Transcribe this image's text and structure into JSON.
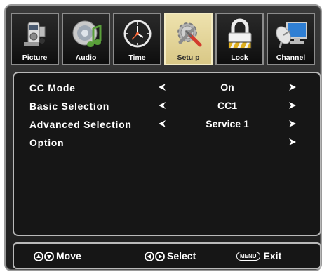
{
  "tabs": [
    {
      "label": "Picture",
      "icon": "camcorder-icon"
    },
    {
      "label": "Audio",
      "icon": "speaker-note-icon"
    },
    {
      "label": "Time",
      "icon": "clock-icon"
    },
    {
      "label": "Setu p",
      "icon": "wrench-gear-icon",
      "active": true
    },
    {
      "label": "Lock",
      "icon": "padlock-icon"
    },
    {
      "label": "Channel",
      "icon": "satellite-dish-icon"
    }
  ],
  "menu": {
    "items": [
      {
        "label": "CC Mode",
        "value": "On"
      },
      {
        "label": "Basic Selection",
        "value": "CC1"
      },
      {
        "label": "Advanced Selection",
        "value": "Service 1"
      },
      {
        "label": "Option",
        "value": ""
      }
    ]
  },
  "footer": {
    "move_label": "Move",
    "select_label": "Select",
    "menu_key": "MENU",
    "exit_label": "Exit"
  },
  "colors": {
    "active_tab": "#e6d79e",
    "background": "#161616",
    "text": "#ffffff",
    "border": "#b9b9b9"
  }
}
